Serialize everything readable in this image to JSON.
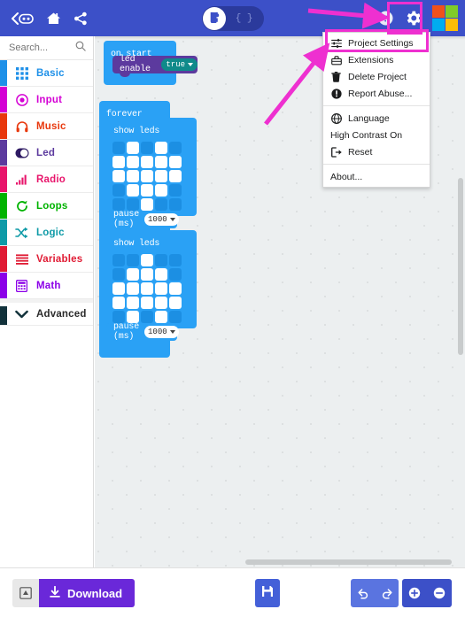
{
  "header": {
    "back_icon": "back-microbit-icon",
    "home_icon": "home-icon",
    "share_icon": "share-icon",
    "toggle": {
      "blocks_icon": "blocks-puzzle-icon",
      "js_label": "{ }"
    },
    "help_icon": "help-question-icon",
    "gear_icon": "gear-icon",
    "logo_colors": [
      "#f1511b",
      "#80cc28",
      "#00adef",
      "#fbbc09"
    ]
  },
  "menu": {
    "items": [
      {
        "label": "Project Settings",
        "icon": "sliders-icon",
        "highlighted": true
      },
      {
        "label": "Extensions",
        "icon": "toolbox-icon",
        "highlighted": false
      },
      {
        "label": "Delete Project",
        "icon": "trash-icon",
        "highlighted": false
      },
      {
        "label": "Report Abuse...",
        "icon": "exclamation-circle-icon",
        "highlighted": false
      }
    ],
    "items2": [
      {
        "label": "Language",
        "icon": "globe-icon"
      },
      {
        "label": "High Contrast On",
        "icon": ""
      },
      {
        "label": "Reset",
        "icon": "sign-out-icon"
      }
    ],
    "items3": [
      {
        "label": "About...",
        "icon": ""
      }
    ]
  },
  "sidebar": {
    "search": {
      "placeholder": "Search...",
      "value": "",
      "icon": "search-icon"
    },
    "categories": [
      {
        "label": "Basic",
        "color": "#1e90e8",
        "icon": "grid-icon"
      },
      {
        "label": "Input",
        "color": "#d400d4",
        "icon": "target-icon"
      },
      {
        "label": "Music",
        "color": "#e8380d",
        "icon": "headphones-icon"
      },
      {
        "label": "Led",
        "color": "#5c3a9e",
        "icon": "toggle-icon"
      },
      {
        "label": "Radio",
        "color": "#e8156b",
        "icon": "signal-bars-icon"
      },
      {
        "label": "Loops",
        "color": "#00b300",
        "icon": "refresh-icon"
      },
      {
        "label": "Logic",
        "color": "#0e9aa7",
        "icon": "shuffle-icon"
      },
      {
        "label": "Variables",
        "color": "#e01b34",
        "icon": "lines-icon"
      },
      {
        "label": "Math",
        "color": "#8b00e8",
        "icon": "calculator-icon"
      }
    ],
    "advanced": {
      "label": "Advanced",
      "icon": "chevron-down-icon",
      "color": "#12323b"
    }
  },
  "workspace": {
    "blocks": {
      "on_start": {
        "label": "on start"
      },
      "led_enable": {
        "label": "led enable",
        "value": "true"
      },
      "forever": {
        "label": "forever"
      },
      "show_leds_1": {
        "label": "show leds",
        "grid": [
          [
            0,
            1,
            0,
            1,
            0
          ],
          [
            1,
            1,
            1,
            1,
            1
          ],
          [
            1,
            1,
            1,
            1,
            1
          ],
          [
            0,
            1,
            1,
            1,
            0
          ],
          [
            0,
            0,
            1,
            0,
            0
          ]
        ]
      },
      "pause_1": {
        "label": "pause (ms)",
        "value": "1000"
      },
      "show_leds_2": {
        "label": "show leds",
        "grid": [
          [
            0,
            0,
            1,
            0,
            0
          ],
          [
            0,
            1,
            1,
            1,
            0
          ],
          [
            1,
            1,
            1,
            1,
            1
          ],
          [
            1,
            1,
            1,
            1,
            1
          ],
          [
            0,
            1,
            0,
            1,
            0
          ]
        ]
      },
      "pause_2": {
        "label": "pause (ms)",
        "value": "1000"
      }
    }
  },
  "bottom": {
    "usb_icon": "usb-device-icon",
    "download_label": "Download",
    "download_icon": "download-icon",
    "save_icon": "save-floppy-icon",
    "undo_icon": "undo-icon",
    "redo_icon": "redo-icon",
    "zoom_in_icon": "zoom-in-icon",
    "zoom_out_icon": "zoom-out-icon"
  },
  "annotations": {
    "highlight_color": "#ee30d0",
    "arrow_to_gear": "arrow-pointing-to-gear-icon",
    "arrow_to_project_settings": "arrow-pointing-to-project-settings"
  }
}
